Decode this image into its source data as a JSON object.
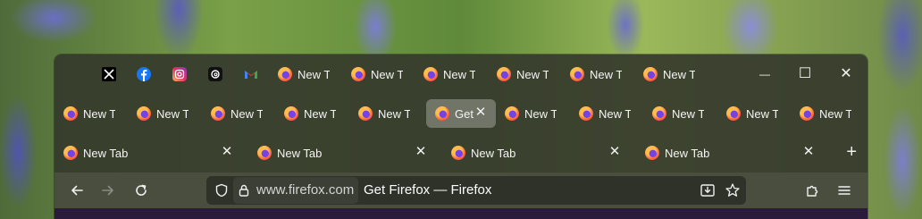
{
  "pinned_tabs": [
    {
      "name": "x-tab",
      "icon": "x-logo-icon"
    },
    {
      "name": "facebook-tab",
      "icon": "facebook-logo-icon"
    },
    {
      "name": "instagram-tab",
      "icon": "instagram-logo-icon"
    },
    {
      "name": "threads-tab",
      "icon": "threads-logo-icon"
    },
    {
      "name": "gmail-tab",
      "icon": "gmail-logo-icon"
    }
  ],
  "row1_tabs": [
    "New Tab",
    "New Tab",
    "New Tab",
    "New Tab",
    "New Tab",
    "New Tab"
  ],
  "row2_tabs": [
    "New Tab",
    "New Tab",
    "New Tab",
    "New Tab",
    "New Tab",
    "Get Firefox",
    "New Tab",
    "New Tab",
    "New Tab",
    "New Tab",
    "New Tab"
  ],
  "row3_tabs": [
    "New Tab",
    "New Tab",
    "New Tab",
    "New Tab"
  ],
  "selected_tab_index_row2": 5,
  "tab_close_glyph": "✕",
  "new_tab_glyph": "+",
  "window_controls": {
    "minimize": "—",
    "maximize": "☐",
    "close": "✕"
  },
  "url_bar": {
    "host": "www.firefox.com",
    "page_title": "Get Firefox — Firefox"
  },
  "colors": {
    "accent": "#ff7139",
    "firefox_purple": "#7542e5",
    "content": "#2a1a3b"
  }
}
